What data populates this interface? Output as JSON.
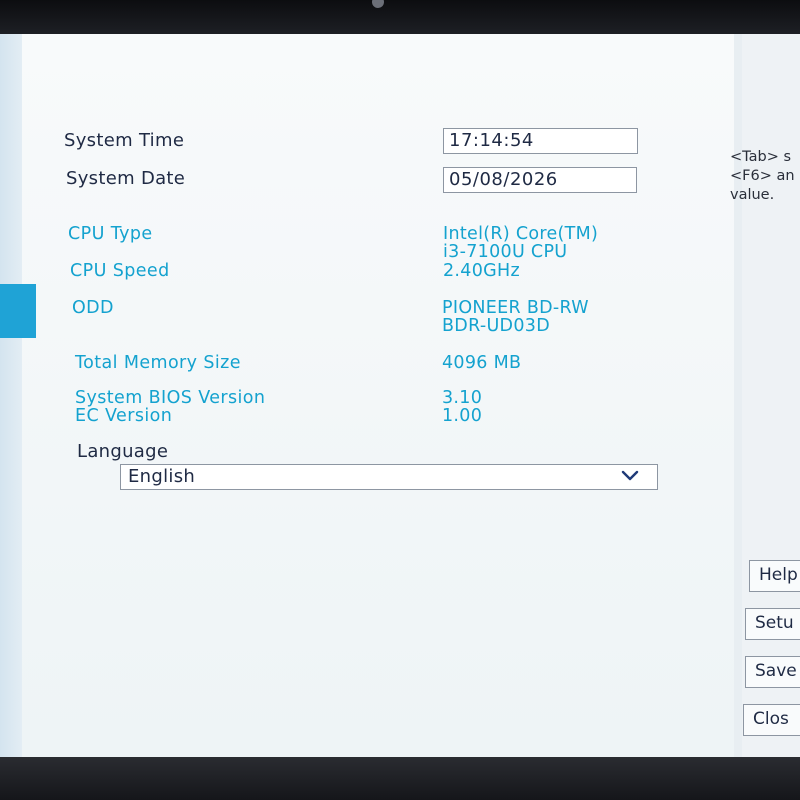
{
  "system": {
    "time_label": "System Time",
    "time_value": "17:14:54",
    "date_label": "System Date",
    "date_value": "05/08/2026"
  },
  "info": {
    "cpu_type_label": "CPU Type",
    "cpu_type_line1": "Intel(R) Core(TM)",
    "cpu_type_line2": "i3-7100U CPU",
    "cpu_speed_label": "CPU Speed",
    "cpu_speed_value": "2.40GHz",
    "odd_label": "ODD",
    "odd_line1": "PIONEER BD-RW",
    "odd_line2": "BDR-UD03D",
    "memory_label": "Total Memory Size",
    "memory_value": "4096 MB",
    "bios_label": "System BIOS Version",
    "bios_value": "3.10",
    "ec_label": "EC Version",
    "ec_value": "1.00"
  },
  "language": {
    "label": "Language",
    "selected": "English",
    "chevron_icon": "chevron-down-icon"
  },
  "help": {
    "line1": "<Tab> s",
    "line2": "<F6> an",
    "line3": "value."
  },
  "side_buttons": {
    "help": "Help",
    "setup": "Setu",
    "save": "Save",
    "close": "Clos"
  },
  "colors": {
    "accent_blue": "#14a2cf",
    "left_tab": "#1fa3d6",
    "text_dark": "#1f2a44"
  }
}
